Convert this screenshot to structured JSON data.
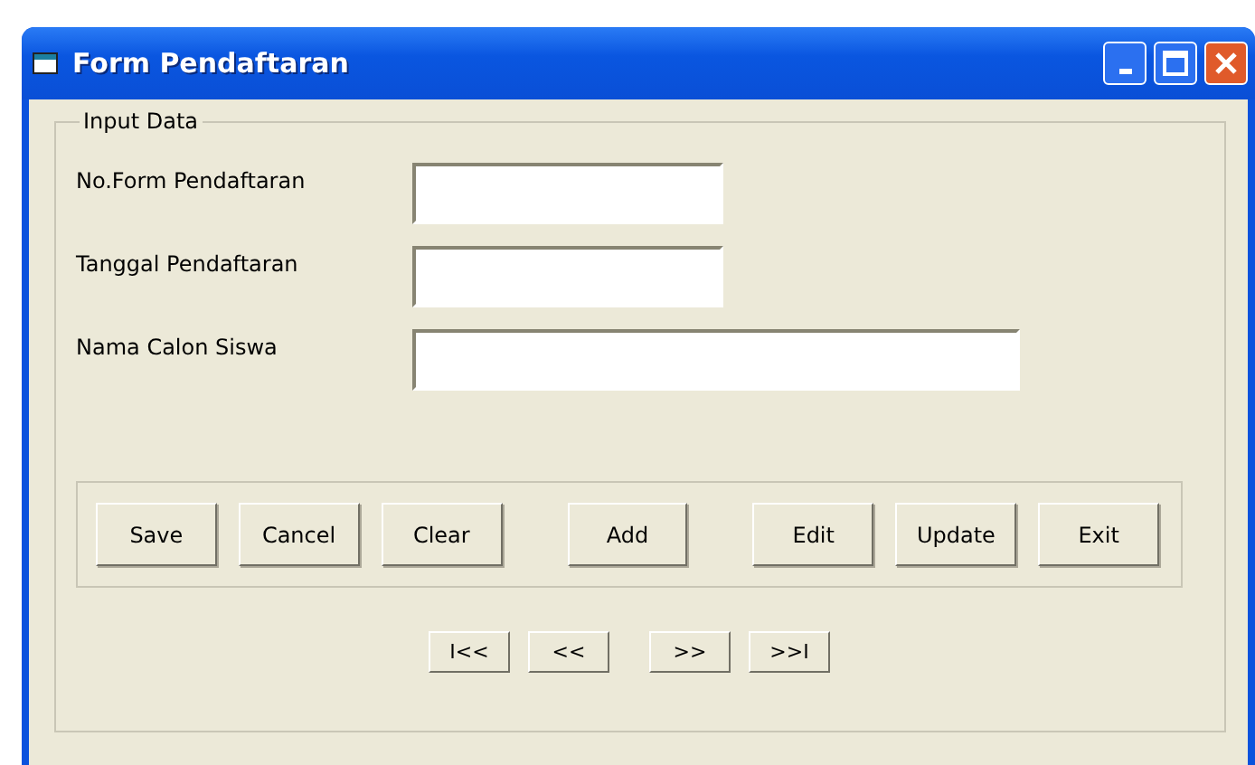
{
  "window": {
    "title": "Form Pendaftaran"
  },
  "frame": {
    "title": "Input Data"
  },
  "fields": [
    {
      "label": "No.Form Pendaftaran",
      "wide": false
    },
    {
      "label": "Tanggal Pendaftaran",
      "wide": false
    },
    {
      "label": "Nama Calon Siswa",
      "wide": true
    }
  ],
  "buttons": [
    "Save",
    "Cancel",
    "Clear",
    "Add",
    "Edit",
    "Update",
    "Exit"
  ],
  "navigation": [
    "I<<",
    "<<",
    ">>",
    ">>I"
  ]
}
